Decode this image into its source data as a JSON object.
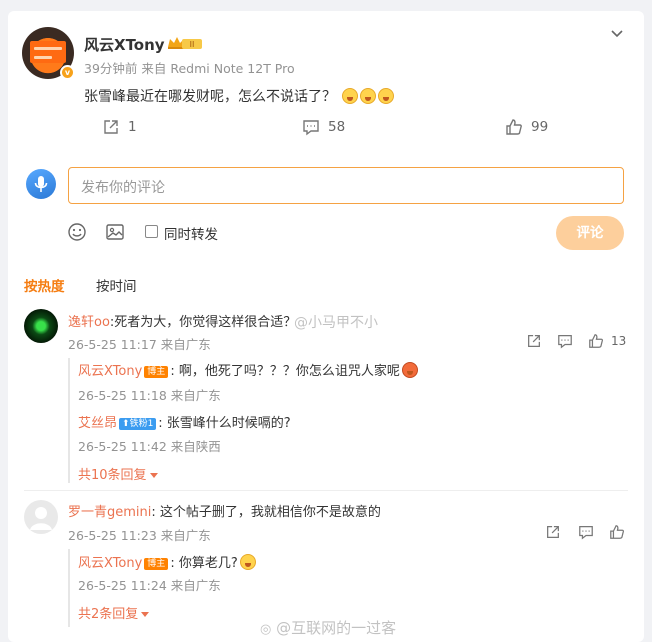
{
  "post": {
    "username": "风云XTony",
    "time_source": "39分钟前 来自 Redmi Note 12T Pro",
    "text": "张雪峰最近在哪发财呢，怎么不说话了？",
    "actions": {
      "repost": "1",
      "comment": "58",
      "like": "99"
    },
    "verified_mark": "v"
  },
  "composer": {
    "placeholder": "发布你的评论",
    "repost_label": "同时转发",
    "submit_label": "评论"
  },
  "tabs": {
    "hot": "按热度",
    "time": "按时间"
  },
  "comments": [
    {
      "name": "逸轩oo",
      "text": ":死者为大，你觉得这样很合适？",
      "meta": "26-5-25 11:17 来自广东",
      "like_count": "13",
      "replies": [
        {
          "name": "风云XTony",
          "tag": "博主",
          "text": ": 啊，他死了吗？？？你怎么诅咒人家呢",
          "meta": "26-5-25 11:18 来自广东"
        },
        {
          "name": "艾丝昂",
          "tag": "铁粉1",
          "text": ": 张雪峰什么时候嗝的?",
          "meta": "26-5-25 11:42 来自陕西"
        }
      ],
      "more": "共10条回复"
    },
    {
      "name": "罗一青gemini",
      "text": ": 这个帖子删了，我就相信你不是故意的",
      "meta": "26-5-25 11:23 来自广东",
      "replies": [
        {
          "name": "风云XTony",
          "tag": "博主",
          "text": ": 你算老几?",
          "meta": "26-5-25 11:24 来自广东"
        }
      ],
      "more": "共2条回复"
    }
  ],
  "watermarks": {
    "middle": "@小马甲不小",
    "bottom": "@互联网的一过客"
  },
  "colors": {
    "accent": "#f57d12",
    "name": "#eb7350",
    "submit_bg": "#fdcf9c",
    "input_border": "#f5a243"
  }
}
